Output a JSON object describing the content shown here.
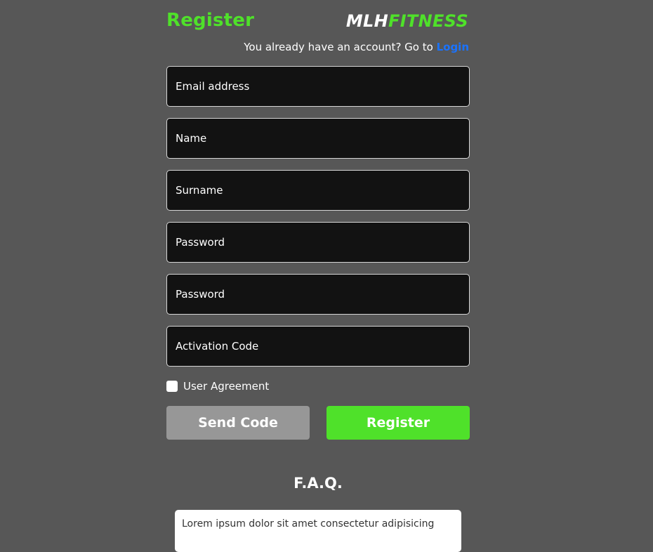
{
  "header": {
    "title": "Register",
    "brand_part1": "MLH",
    "brand_part2": "FITNESS",
    "login_prompt": "You already have an account? Go to",
    "login_link": "Login"
  },
  "form": {
    "fields": [
      {
        "placeholder": "Email address",
        "value": ""
      },
      {
        "placeholder": "Name",
        "value": ""
      },
      {
        "placeholder": "Surname",
        "value": ""
      },
      {
        "placeholder": "Password",
        "value": ""
      },
      {
        "placeholder": "Password",
        "value": ""
      },
      {
        "placeholder": "Activation Code",
        "value": ""
      }
    ],
    "agreement_label": "User Agreement",
    "agreement_checked": false,
    "send_code_label": "Send Code",
    "register_label": "Register"
  },
  "faq": {
    "title": "F.A.Q.",
    "first_item_text": "Lorem ipsum dolor sit amet consectetur adipisicing"
  },
  "colors": {
    "background": "#575757",
    "accent_green": "#4fe12a",
    "link_blue": "#1a73ff",
    "field_bg": "#121212",
    "send_button": "#979797"
  }
}
